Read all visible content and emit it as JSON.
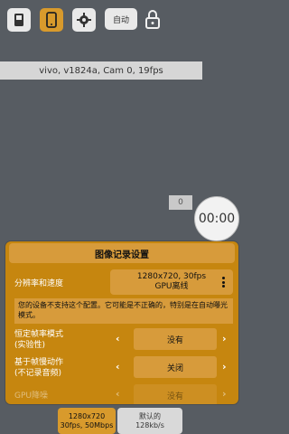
{
  "toolbar": {
    "auto_label": "自动",
    "buttons": [
      {
        "icon": "sd-card-icon"
      },
      {
        "icon": "phone-icon",
        "active": true
      },
      {
        "icon": "gear-icon"
      },
      {
        "icon": "lock-icon"
      }
    ]
  },
  "info": {
    "text": "vivo, v1824a, Cam 0, 19fps"
  },
  "counter": {
    "value": "0"
  },
  "timer": {
    "value": "00:00"
  },
  "settings": {
    "title": "图像记录设置",
    "resolution": {
      "label": "分辨率和速度",
      "value_line1": "1280x720, 30fps",
      "value_line2": "GPU离线"
    },
    "warning": "您的设备不支持这个配置。它可能是不正确的，特别是在自动曝光模式。",
    "framerate": {
      "label_line1": "恒定帧率模式",
      "label_line2": "(实验性)",
      "value": "没有"
    },
    "slowmo": {
      "label_line1": "基于帧慢动作",
      "label_line2": "(不记录音频)",
      "value": "关闭"
    },
    "gpu": {
      "label": "GPU降噪",
      "value": "没有"
    }
  },
  "bottom": {
    "video": {
      "line1": "1280x720",
      "line2": "30fps, 50Mbps"
    },
    "audio": {
      "line1": "默认的",
      "line2": "128kb/s"
    }
  },
  "colors": {
    "accent": "#d89a2c",
    "panel": "#c6860f",
    "background": "#575c62"
  }
}
